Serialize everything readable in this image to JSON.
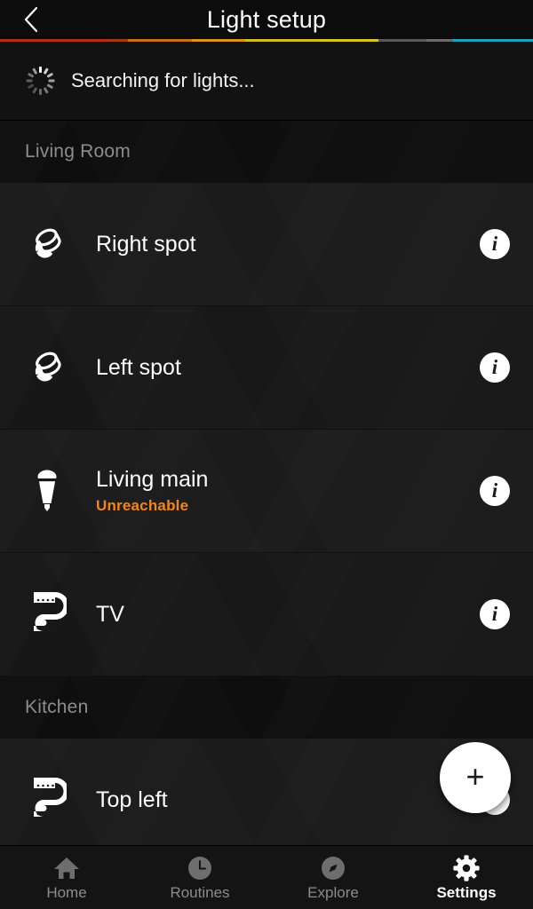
{
  "header": {
    "title": "Light setup",
    "back_icon": "chevron-left-icon",
    "gradient_segments": [
      {
        "color": "#b32d14",
        "width": 20
      },
      {
        "color": "#a33b10",
        "width": 4
      },
      {
        "color": "#c8701b",
        "width": 12
      },
      {
        "color": "#d8941f",
        "width": 10
      },
      {
        "color": "#cfbe23",
        "width": 14
      },
      {
        "color": "#d5c423",
        "width": 11
      },
      {
        "color": "#5a5a5a",
        "width": 9
      },
      {
        "color": "#6b6b6b",
        "width": 5
      },
      {
        "color": "#1fa3b8",
        "width": 15
      }
    ]
  },
  "search_status": {
    "icon": "spinner-icon",
    "text": "Searching for lights..."
  },
  "sections": [
    {
      "name": "Living Room",
      "lights": [
        {
          "name": "Right spot",
          "icon": "spot-light-icon",
          "status": "",
          "status_color": "#f0861a",
          "info_icon": "info-icon"
        },
        {
          "name": "Left spot",
          "icon": "spot-light-icon",
          "status": "",
          "status_color": "#f0861a",
          "info_icon": "info-icon"
        },
        {
          "name": "Living main",
          "icon": "bulb-light-icon",
          "status": "Unreachable",
          "status_color": "#f0861a",
          "info_icon": "info-icon"
        },
        {
          "name": "TV",
          "icon": "light-strip-icon",
          "status": "",
          "status_color": "#f0861a",
          "info_icon": "info-icon"
        }
      ]
    },
    {
      "name": "Kitchen",
      "lights": [
        {
          "name": "Top left",
          "icon": "light-strip-icon",
          "status": "",
          "status_color": "#f0861a",
          "info_icon": "info-icon"
        }
      ]
    }
  ],
  "fab": {
    "label": "+",
    "icon": "plus-icon"
  },
  "bottom_nav": {
    "items": [
      {
        "label": "Home",
        "icon": "home-icon",
        "active": false
      },
      {
        "label": "Routines",
        "icon": "clock-icon",
        "active": false
      },
      {
        "label": "Explore",
        "icon": "compass-icon",
        "active": false
      },
      {
        "label": "Settings",
        "icon": "gear-icon",
        "active": true
      }
    ]
  },
  "colors": {
    "accent_orange": "#f0861a",
    "background": "#0d0d0d",
    "row_background": "#1d1d1d",
    "text_primary": "#ffffff",
    "text_secondary": "#8d8d8d"
  }
}
